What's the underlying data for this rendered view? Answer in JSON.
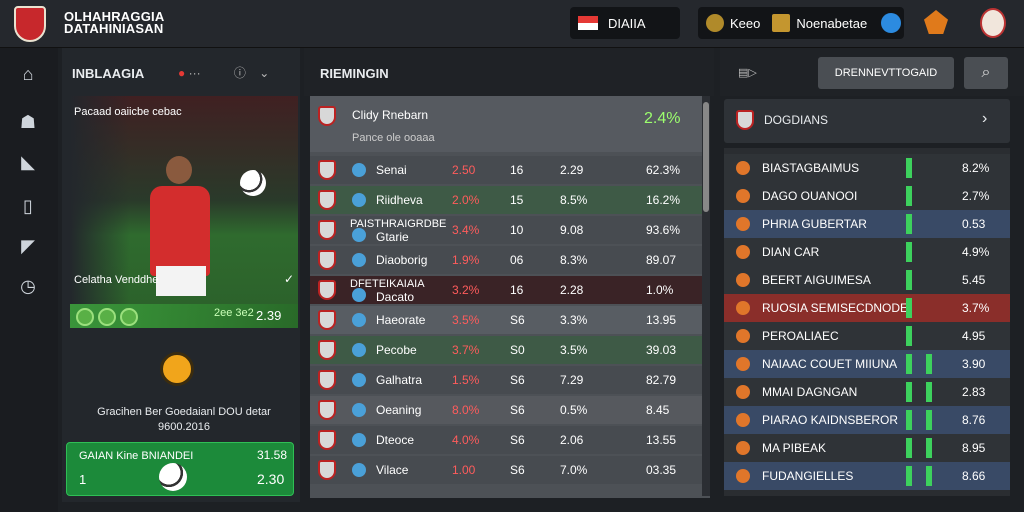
{
  "header": {
    "brand_line1": "OLHAHRAGGIA",
    "brand_line2": "DATAHINIASAN",
    "region_label": "DIAIIA",
    "account_a": "Keeo",
    "account_b": "Noenabetae"
  },
  "sidebar": {
    "icons": [
      "home-icon",
      "users-icon",
      "chart-icon",
      "book-icon",
      "megaphone-icon",
      "clock-icon"
    ]
  },
  "left": {
    "title": "INBLAAGIA",
    "hero_caption": "Pacaad oaiicbe cebac",
    "hero_label": "Celatha Venddhe",
    "hero_mid": "2ee 3e2",
    "hero_score": "2.39",
    "promo_text": "Gracihen Ber Goedaianl DOU detar",
    "promo_sub": "9600.2016",
    "card_title": "GAIAN Kine BNIANDEI",
    "card_sub": "1",
    "card_v1": "31.58",
    "card_v2": "2.30"
  },
  "middle": {
    "title": "RIEMINGIN",
    "header_row": {
      "name": "Clidy Rnebarn",
      "sub": "Pance ole ooaaa",
      "value": "2.4%"
    },
    "rows": [
      {
        "name": "Senai",
        "c1": "2.50",
        "c2": "16",
        "c3": "2.29",
        "c4": "62.3%",
        "bg": "#474b50",
        "c4color": "#e8f0ee"
      },
      {
        "name": "Riidheva",
        "c1": "2.0%",
        "c2": "15",
        "c3": "8.5%",
        "c4": "16.2%",
        "bg": "#3e5a46",
        "c4color": "#e8f0ee"
      },
      {
        "name": "Gtarie",
        "sub": "PAISTHRAIGRDBE",
        "c1": "3.4%",
        "c2": "10",
        "c3": "9.08",
        "c4": "93.6%",
        "bg": "#474b50",
        "c4color": "#e8f0ee"
      },
      {
        "name": "Diaoborig",
        "c1": "1.9%",
        "c2": "06",
        "c3": "8.3%",
        "c4": "89.07",
        "bg": "#474b50",
        "c4color": "#e8f0ee"
      },
      {
        "name": "Dacato",
        "sub": "DFETEIKAIAIA",
        "c1": "3.2%",
        "c2": "16",
        "c3": "2.28",
        "c4": "1.0%",
        "bg": "#3a2326",
        "c4color": "#e8f0ee"
      },
      {
        "name": "Haeorate",
        "c1": "3.5%",
        "c2": "S6",
        "c3": "3.3%",
        "c4": "13.95",
        "bg": "#585d63",
        "c4color": "#e8f0ee"
      },
      {
        "name": "Pecobe",
        "c1": "3.7%",
        "c2": "S0",
        "c3": "3.5%",
        "c4": "39.03",
        "bg": "#3e5a46",
        "c4color": "#e8f0ee"
      },
      {
        "name": "Galhatra",
        "c1": "1.5%",
        "c2": "S6",
        "c3": "7.29",
        "c4": "82.79",
        "bg": "#474b50",
        "c4color": "#e8f0ee"
      },
      {
        "name": "Oeaning",
        "c1": "8.0%",
        "c2": "S6",
        "c3": "0.5%",
        "c4": "8.45",
        "bg": "#56595e",
        "c4color": "#e8f0ee"
      },
      {
        "name": "Dteoce",
        "c1": "4.0%",
        "c2": "S6",
        "c3": "2.06",
        "c4": "13.55",
        "bg": "#474b50",
        "c4color": "#e8f0ee"
      },
      {
        "name": "Vilace",
        "c1": "1.00",
        "c2": "S6",
        "c3": "7.0%",
        "c4": "03.35",
        "bg": "#474b50",
        "c4color": "#e8f0ee"
      }
    ]
  },
  "right": {
    "button_label": "DRENNEVTTOGAID",
    "card_title": "DOGDIANS",
    "rows": [
      {
        "name": "BIASTAGBAIMUS",
        "v": "8.2%",
        "bg": "#2f3337"
      },
      {
        "name": "DAGO OUANOOI",
        "v": "2.7%",
        "bg": "#2f3337"
      },
      {
        "name": "PHRIA GUBERTAR",
        "v": "0.53",
        "bg": "#394a66"
      },
      {
        "name": "DIAN CAR",
        "v": "4.9%",
        "bg": "#2f3337"
      },
      {
        "name": "BEERT AIGUIMESA",
        "v": "5.45",
        "bg": "#2f3337"
      },
      {
        "name": "RUOSIA SEMISECDNODE",
        "v": "3.7%",
        "bg": "#8a2e2a"
      },
      {
        "name": "PEROALIAEC",
        "v": "4.95",
        "bg": "#2f3337"
      },
      {
        "name": "NAIAAC COUET MIIUNA",
        "v": "3.90",
        "bg": "#394a66"
      },
      {
        "name": "MMAI DAGNGAN",
        "v": "2.83",
        "bg": "#2f3337"
      },
      {
        "name": "PIARAO KAIDNSBEROR",
        "v": "8.76",
        "bg": "#394a66"
      },
      {
        "name": "MA PIBEAK",
        "v": "8.95",
        "bg": "#2f3337"
      },
      {
        "name": "FUDANGIELLES",
        "v": "8.66",
        "bg": "#394a66"
      }
    ]
  },
  "colors": {
    "accent": "#3dd15d",
    "danger": "#ff5c5c",
    "gold": "#f1a51b"
  }
}
